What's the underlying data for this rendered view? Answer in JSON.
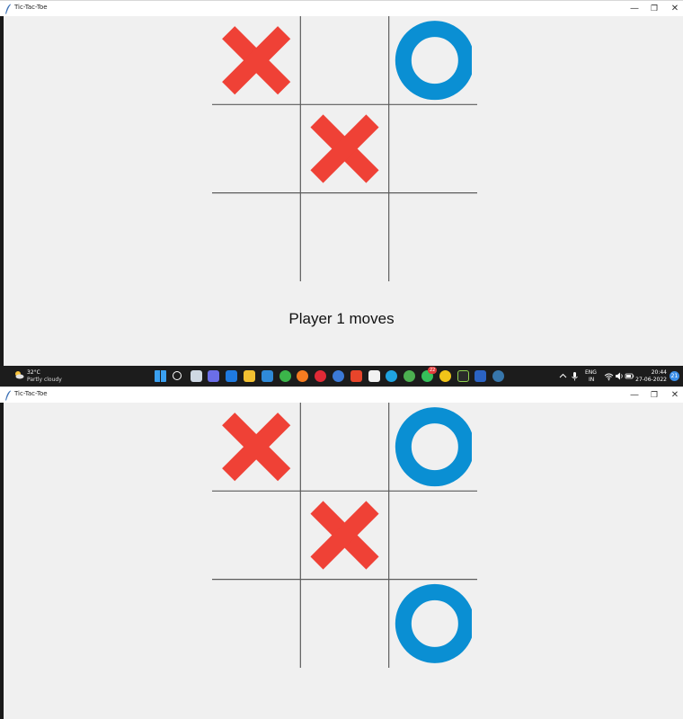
{
  "window": {
    "title": "Tic-Tac-Toe",
    "minimize_glyph": "—",
    "maximize_glyph": "❐",
    "close_glyph": "✕"
  },
  "colors": {
    "x_mark": "#ef4136",
    "o_mark": "#0a8fd3",
    "grid": "#5c5c5c",
    "background": "#f0f0f0",
    "taskbar": "#1c1c1c"
  },
  "screens": [
    {
      "status": "Player 1 moves",
      "board": [
        [
          "X",
          "",
          "O"
        ],
        [
          "",
          "X",
          ""
        ],
        [
          "",
          "",
          ""
        ]
      ]
    },
    {
      "status": "",
      "board": [
        [
          "X",
          "",
          "O"
        ],
        [
          "",
          "X",
          ""
        ],
        [
          "",
          "",
          "O"
        ]
      ]
    }
  ],
  "taskbar": {
    "weather_temp": "32°C",
    "weather_desc": "Partly cloudy",
    "apps": [
      "start-icon",
      "search-icon",
      "task-view-icon",
      "teams-chat-icon",
      "l-app-icon",
      "file-explorer-icon",
      "mail-icon",
      "upwork-icon",
      "firefox-icon",
      "opera-icon",
      "copyright-app-icon",
      "office-icon",
      "calendar-icon",
      "edge-icon",
      "chrome-icon",
      "whatsapp-icon",
      "chrome-profile-icon",
      "terminal-icon",
      "word-icon",
      "python-icon"
    ],
    "whatsapp_badge": "22",
    "language": "ENG",
    "region": "IN",
    "time": "20:44",
    "date": "27-06-2022",
    "notifications": "21"
  }
}
